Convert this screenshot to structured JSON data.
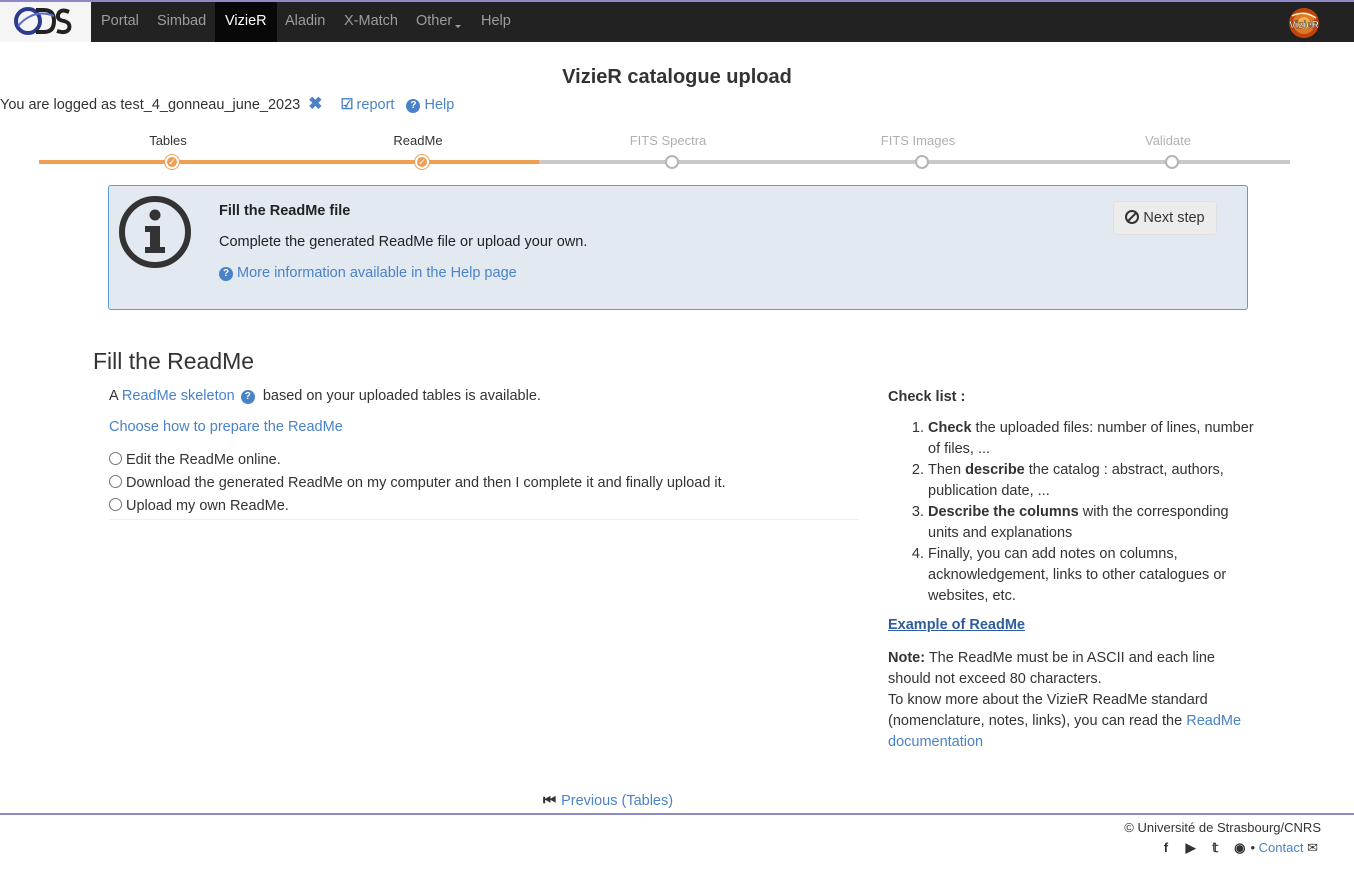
{
  "nav": {
    "items": [
      {
        "label": "Portal",
        "active": false
      },
      {
        "label": "Simbad",
        "active": false
      },
      {
        "label": "VizieR",
        "active": true
      },
      {
        "label": "Aladin",
        "active": false
      },
      {
        "label": "X-Match",
        "active": false
      },
      {
        "label": "Other",
        "active": false
      },
      {
        "label": "Help",
        "active": false
      }
    ],
    "brand": "CDS",
    "vizier_logo": "VizieR"
  },
  "header": {
    "title": "VizieR catalogue upload",
    "logged_prefix": "You are logged as",
    "username": "test_4_gonneau_june_2023",
    "report_label": "report",
    "help_label": "Help"
  },
  "stepper": {
    "steps": [
      {
        "label": "Tables",
        "state": "done"
      },
      {
        "label": "ReadMe",
        "state": "done"
      },
      {
        "label": "FITS Spectra",
        "state": "todo"
      },
      {
        "label": "FITS Images",
        "state": "todo"
      },
      {
        "label": "Validate",
        "state": "todo"
      }
    ],
    "accent": "#ef9f54",
    "inactive": "#c8c8c8"
  },
  "info": {
    "title": "Fill the ReadMe file",
    "text": "Complete the generated ReadMe file or upload your own.",
    "link": "More information available in the Help page",
    "next_button": "Next step"
  },
  "main": {
    "section_title": "Fill the ReadMe",
    "skeleton_prefix": "A",
    "skeleton_link": "ReadMe skeleton",
    "skeleton_suffix": "based on your uploaded tables is available.",
    "choose_link": "Choose how to prepare the ReadMe",
    "options": [
      "Edit the ReadMe online.",
      "Download the generated ReadMe on my computer and then I complete it and finally upload it.",
      "Upload my own ReadMe."
    ]
  },
  "checklist": {
    "title": "Check list :",
    "items": [
      {
        "bold": "Check",
        "rest": " the uploaded files: number of lines, number of files, ..."
      },
      {
        "prefix": "Then ",
        "bold": "describe",
        "rest": " the catalog : abstract, authors, publication date, ..."
      },
      {
        "bold": "Describe the columns",
        "rest": " with the corresponding units and explanations"
      },
      {
        "rest": "Finally, you can add notes on columns, acknowledgement, links to other catalogues or websites, etc."
      }
    ],
    "example_link": "Example of ReadMe",
    "note_label": "Note:",
    "note_text": " The ReadMe must be in ASCII and each line should not exceed 80 characters.",
    "more_text": "To know more about the VizieR ReadMe standard (nomenclature, notes, links), you can read the ",
    "doc_link": "ReadMe documentation"
  },
  "footer": {
    "prev_link": "Previous (Tables)",
    "copyright": "© Université de Strasbourg/CNRS",
    "contact": "Contact",
    "social_icons": [
      "facebook-icon",
      "youtube-icon",
      "twitter-icon",
      "github-icon"
    ]
  }
}
